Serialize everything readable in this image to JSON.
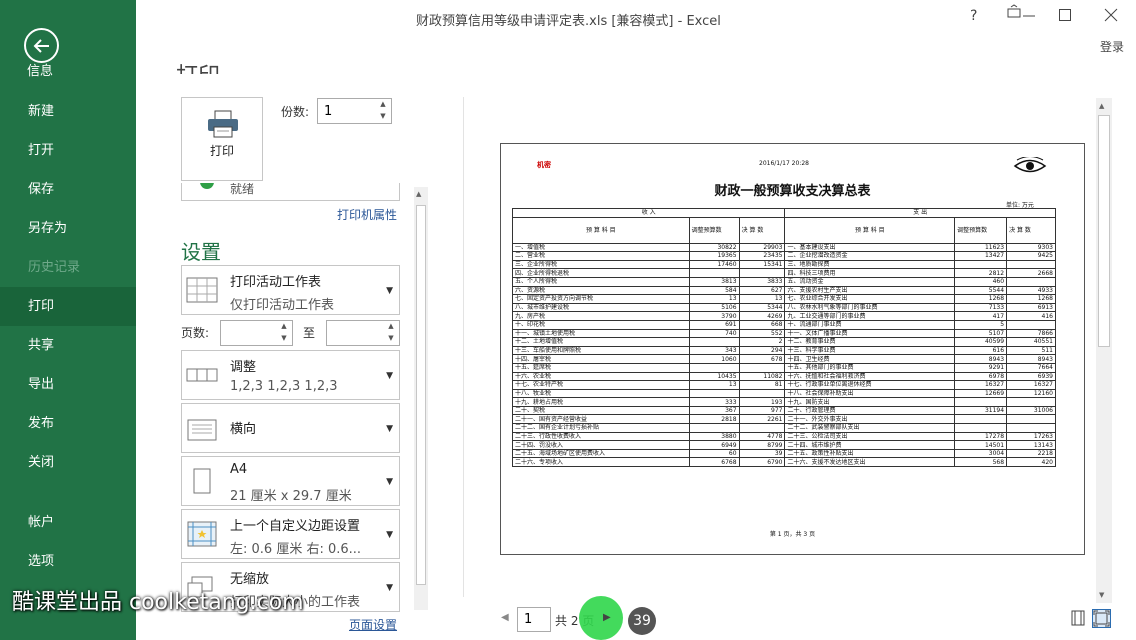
{
  "nav": {
    "back_label": "信息",
    "items": [
      "新建",
      "打开",
      "保存",
      "另存为",
      "历史记录",
      "打印",
      "共享",
      "导出",
      "发布",
      "关闭"
    ],
    "bottom_items": [
      "帐户",
      "选项"
    ]
  },
  "window": {
    "title": "财政预算信用等级申请评定表.xls  [兼容模式] - Excel",
    "help": "?",
    "login": "登录"
  },
  "print": {
    "heading": "打印",
    "button_label": "打印",
    "copies_label": "份数:",
    "copies_value": "1",
    "printer_status": "就绪",
    "printer_props_link": "打印机属性",
    "settings_heading": "设置",
    "what": {
      "title": "打印活动工作表",
      "sub": "仅打印活动工作表"
    },
    "pages_label": "页数:",
    "pages_to": "至",
    "collate": {
      "title": "调整",
      "sub": "1,2,3    1,2,3    1,2,3"
    },
    "orientation": {
      "title": "横向"
    },
    "paper": {
      "title": "A4",
      "sub": "21 厘米 x 29.7 厘米"
    },
    "margins": {
      "title": "上一个自定义边距设置",
      "sub": "左: 0.6 厘米    右: 0.6..."
    },
    "scaling": {
      "title": "无缩放",
      "sub": "打印实际大小的工作表"
    },
    "page_setup_link": "页面设置"
  },
  "preview": {
    "secret": "机密",
    "timestamp": "2016/1/17  20:28",
    "title": "财政一般预算收支决算总表",
    "unit": "单位: 万元",
    "head_in": "收                入",
    "head_out": "支                出",
    "col_item": "预     算     科     目",
    "col_budget": "调整预算数",
    "col_final": "决 算 数",
    "rows": [
      [
        "一、增值税",
        "30822",
        "29903",
        "一、基本建设支出",
        "11623",
        "9303"
      ],
      [
        "二、营业税",
        "19365",
        "23435",
        "二、企业挖潜改造资金",
        "13427",
        "9425"
      ],
      [
        "三、企业所得税",
        "17460",
        "15341",
        "三、地质勘探费",
        "",
        ""
      ],
      [
        "四、企业所得税退税",
        "",
        "",
        "四、科技三项费用",
        "2812",
        "2668"
      ],
      [
        "五、个人所得税",
        "3813",
        "3833",
        "五、流动资金",
        "460",
        ""
      ],
      [
        "六、资源税",
        "584",
        "627",
        "六、支援农村生产支出",
        "5544",
        "4933"
      ],
      [
        "七、固定资产投资方向调节税",
        "13",
        "13",
        "七、农业综合开发支出",
        "1268",
        "1268"
      ],
      [
        "八、城市维护建设税",
        "5106",
        "5344",
        "八、农林水利气象等部门的事业费",
        "7133",
        "6913"
      ],
      [
        "九、房产税",
        "3790",
        "4269",
        "九、工业交通等部门的事业费",
        "417",
        "416"
      ],
      [
        "十、印花税",
        "691",
        "668",
        "十、流通部门事业费",
        "5",
        ""
      ],
      [
        "十一、城镇土地使用税",
        "740",
        "552",
        "十一、文体广播事业费",
        "5107",
        "7866"
      ],
      [
        "十二、土地增值税",
        "",
        "2",
        "十二、教育事业费",
        "40599",
        "40551"
      ],
      [
        "十三、车船使用和牌照税",
        "343",
        "294",
        "十三、科学事业费",
        "616",
        "511"
      ],
      [
        "十四、屠宰税",
        "1060",
        "678",
        "十四、卫生经费",
        "8943",
        "8943"
      ],
      [
        "十五、筵席税",
        "",
        "",
        "十五、其他部门的事业费",
        "9291",
        "7664"
      ],
      [
        "十六、农业税",
        "10435",
        "11082",
        "十六、抚恤和社会福利救济费",
        "6978",
        "6939"
      ],
      [
        "十七、农业特产税",
        "13",
        "81",
        "十七、行政事业单位离退休经费",
        "16327",
        "16327"
      ],
      [
        "十八、牧业税",
        "",
        "",
        "十八、社会保障补助支出",
        "12669",
        "12160"
      ],
      [
        "十九、耕地占用税",
        "333",
        "193",
        "十九、国防支出",
        "",
        ""
      ],
      [
        "二十、契税",
        "367",
        "977",
        "二十、行政管理费",
        "31194",
        "31006"
      ],
      [
        "二十一、国有资产经营收益",
        "2818",
        "2261",
        "二十一、外交外事支出",
        "",
        ""
      ],
      [
        "二十二、国有企业计划亏损补贴",
        "",
        "",
        "二十二、武装警察部队支出",
        "",
        ""
      ],
      [
        "二十三、行政性收费收入",
        "3880",
        "4778",
        "二十三、公检法司支出",
        "17278",
        "17263"
      ],
      [
        "二十四、罚没收入",
        "6949",
        "8799",
        "二十四、城市维护费",
        "14501",
        "13143"
      ],
      [
        "二十五、海域场地矿区使用费收入",
        "60",
        "39",
        "二十五、政策性补贴支出",
        "3004",
        "2218"
      ],
      [
        "二十六、专项收入",
        "6768",
        "6790",
        "二十六、支援不发达地区支出",
        "568",
        "420"
      ]
    ],
    "page_footer": "第 1 页，共 3 页"
  },
  "footer": {
    "page_value": "1",
    "page_total": "共 2 页",
    "badge": "39"
  },
  "watermark": "酷课堂出品  coolketang.com",
  "colors": {
    "accent": "#217346",
    "nav_active": "#19643a",
    "link": "#2b5797"
  }
}
